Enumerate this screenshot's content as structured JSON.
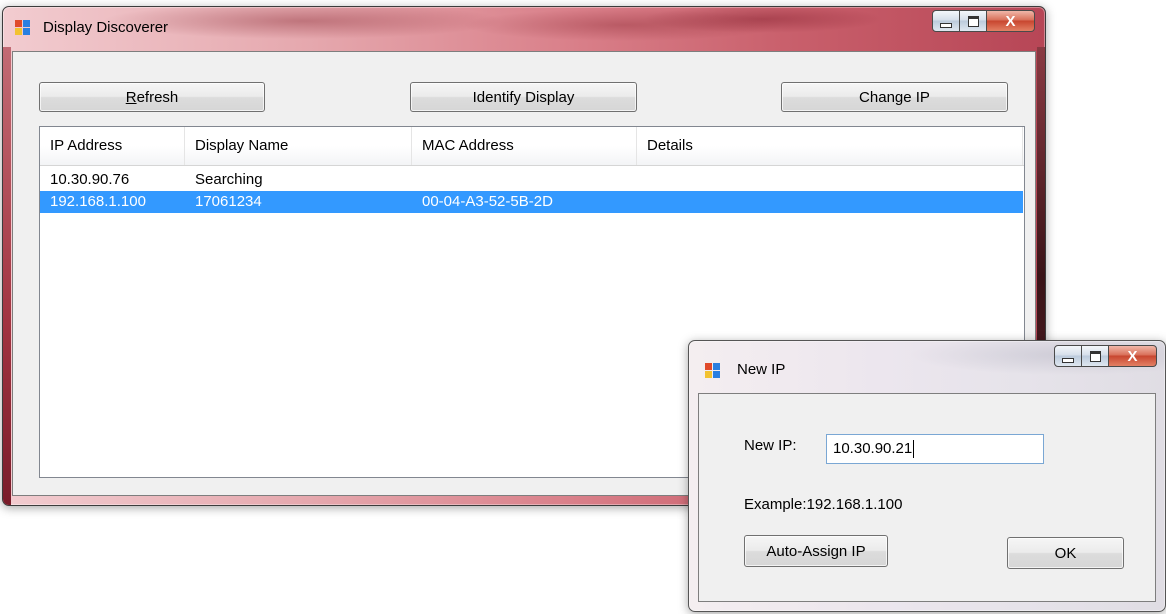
{
  "main_window": {
    "title": "Display Discoverer",
    "buttons": {
      "refresh_label": "Refresh",
      "identify_label": "Identify Display",
      "change_ip_label": "Change IP"
    },
    "list": {
      "columns": [
        "IP Address",
        "Display Name",
        "MAC Address",
        "Details"
      ],
      "rows": [
        [
          "10.30.90.76",
          "Searching",
          "",
          ""
        ],
        [
          "192.168.1.100",
          "17061234",
          "00-04-A3-52-5B-2D",
          ""
        ]
      ],
      "selected_row": 1
    }
  },
  "dialog": {
    "title": "New IP",
    "new_ip_label": "New IP:",
    "new_ip_value": "10.30.90.21",
    "example_text": "Example:192.168.1.100",
    "auto_assign_label": "Auto-Assign IP",
    "ok_label": "OK"
  },
  "colors": {
    "selection": "#3399ff",
    "close_button": "#c8462f"
  },
  "icons": [
    "app-icon",
    "minimize-icon",
    "maximize-icon",
    "close-icon"
  ]
}
